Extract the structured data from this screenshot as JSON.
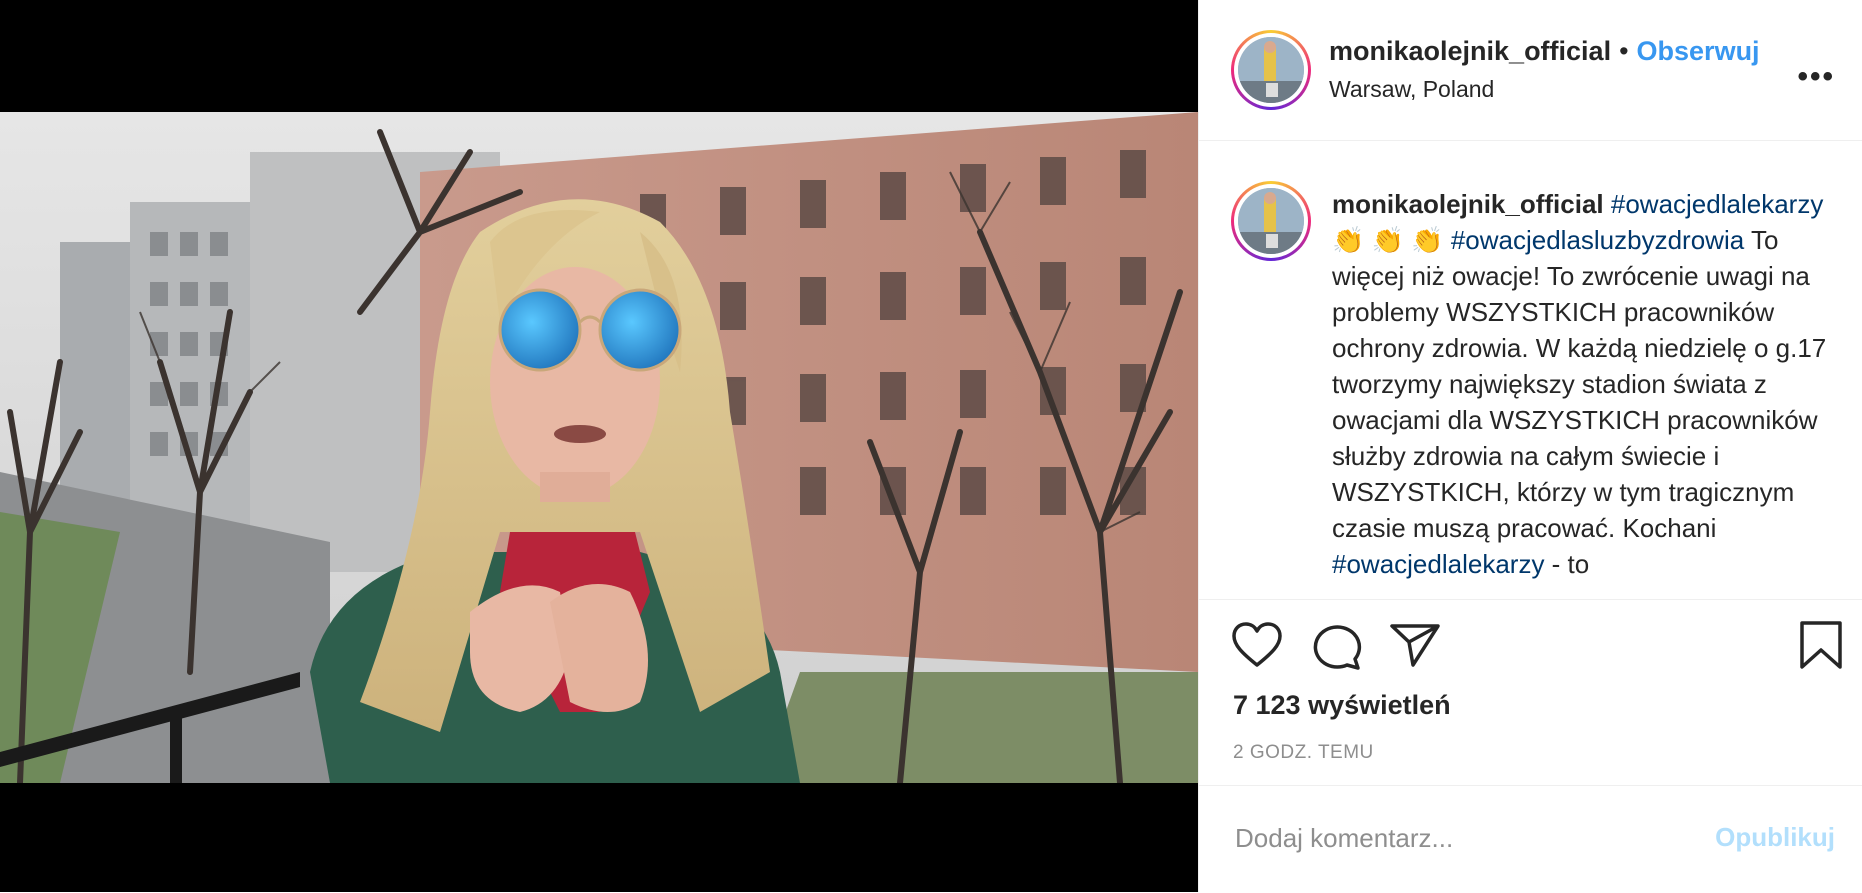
{
  "post": {
    "username": "monikaolejnik_official",
    "follow_label": "Obserwuj",
    "separator": "•",
    "location": "Warsaw, Poland",
    "more_label": "•••"
  },
  "caption": {
    "username": "monikaolejnik_official",
    "hashtag_1": "#owacjedlalekarzy",
    "emojis": "👏 👏 👏",
    "hashtag_2": "#owacjedlasluzbyzdrowia",
    "text_1": " To więcej niż owacje! To zwrócenie uwagi na problemy WSZYSTKICH pracowników ochrony zdrowia. W każdą niedzielę o g.17 tworzymy największy stadion świata z owacjami dla WSZYSTKICH pracowników służby zdrowia na całym świecie i WSZYSTKICH, którzy w tym tragicznym czasie muszą pracować. Kochani ",
    "hashtag_3": "#owacjedlalekarzy",
    "text_2": " - to"
  },
  "stats": {
    "views": "7 123 wyświetleń",
    "time_ago": "2 GODZ. TEMU"
  },
  "comment": {
    "placeholder": "Dodaj komentarz...",
    "publish_label": "Opublikuj"
  },
  "icons": {
    "like": "heart-icon",
    "comment": "comment-bubble-icon",
    "share": "paper-plane-icon",
    "save": "bookmark-icon",
    "more": "more-options-icon"
  },
  "colors": {
    "accent": "#3897f0",
    "hashtag": "#00376b",
    "publish_disabled": "#b2dffc",
    "secondary_text": "#8e8e8e"
  }
}
